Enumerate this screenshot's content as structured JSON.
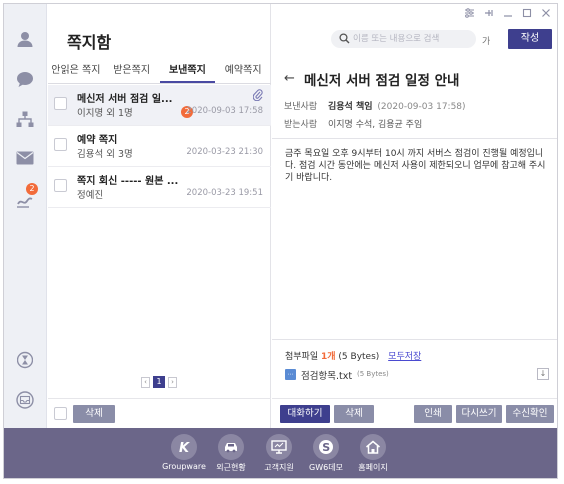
{
  "app": {
    "title": "쪽지함"
  },
  "rail": {
    "badge_count": "2"
  },
  "tabs": [
    {
      "label": "안읽은 쪽지"
    },
    {
      "label": "받은쪽지"
    },
    {
      "label": "보낸쪽지",
      "active": true
    },
    {
      "label": "예약쪽지"
    }
  ],
  "messages": [
    {
      "title": "메신저 서버 점검 일...",
      "sender": "이지명 외 1명",
      "date": "2020-09-03 17:58",
      "badge": "2",
      "has_attachment": true,
      "selected": true
    },
    {
      "title": "예약 쪽지",
      "sender": "김용석 외 3명",
      "date": "2020-03-23 21:30"
    },
    {
      "title": "쪽지 회신 ----- 원본 ...",
      "sender": "정예진",
      "date": "2020-03-23 19:51"
    }
  ],
  "pager": {
    "current": "1"
  },
  "list_footer": {
    "delete_label": "삭제"
  },
  "search": {
    "placeholder": "이름 또는 내용으로 검색",
    "option_label": "가"
  },
  "compose_label": "작성",
  "reader": {
    "subject": "메신저 서버 점검 일정 안내",
    "sender_label": "보낸사람",
    "sender_name": "김용석 책임",
    "sent_at": "(2020-09-03 17:58)",
    "recipient_label": "받는사람",
    "recipients": "이지명 수석, 김용균 주임",
    "body": "금주 목요일 오후 9시부터 10시 까지 서버스 점검이 진행될 예정입니다. 점검 시간 동안에는 메신저 사용이 제한되오니 업무에 참고해 주시기 바랍니다.",
    "attachment_label": "첨부파일",
    "attachment_count": "1개",
    "attachment_total": "(5 Bytes)",
    "save_all_label": "모두저장",
    "file": {
      "name": "점검항목.txt",
      "size": "(5 Bytes)"
    },
    "buttons": {
      "reply": "대화하기",
      "delete": "삭제",
      "print": "인쇄",
      "resend": "다시쓰기",
      "read_check": "수신확인"
    }
  },
  "dock": [
    {
      "label": "Groupware",
      "icon": "k-logo-icon"
    },
    {
      "label": "외근현황",
      "icon": "car-icon"
    },
    {
      "label": "고객지원",
      "icon": "monitor-icon"
    },
    {
      "label": "GW6데모",
      "icon": "s-logo-icon"
    },
    {
      "label": "홈페이지",
      "icon": "home-icon"
    }
  ],
  "colors": {
    "accent": "#3e3f8e",
    "badge": "#f26b3a",
    "dock": "#6b6689",
    "button_secondary": "#8a8da8"
  }
}
